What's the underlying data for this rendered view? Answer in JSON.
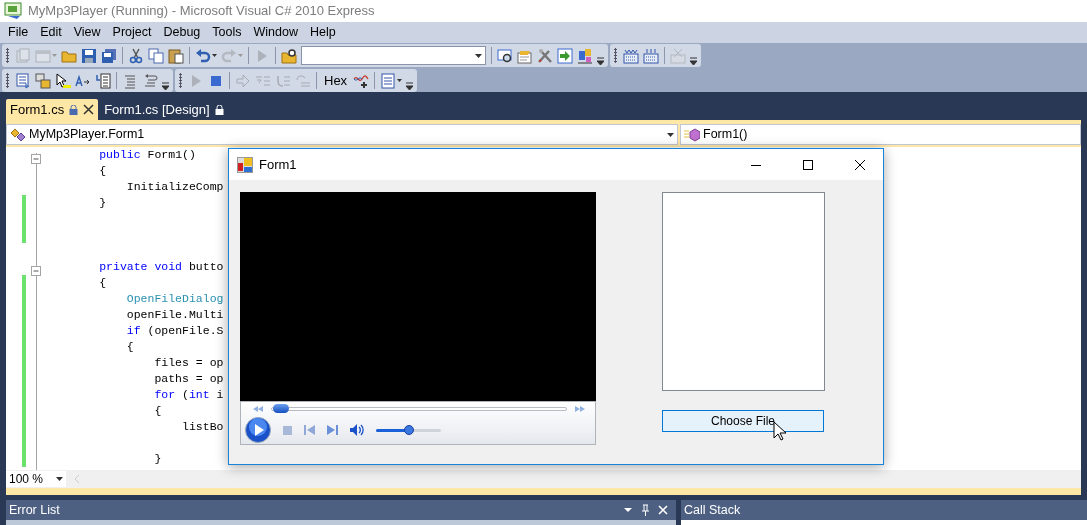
{
  "window": {
    "title": "MyMp3Player (Running) - Microsoft Visual C# 2010 Express"
  },
  "menu": [
    "File",
    "Edit",
    "View",
    "Project",
    "Debug",
    "Tools",
    "Window",
    "Help"
  ],
  "toolbars": [
    {
      "items": [
        {
          "kind": "button",
          "disabled": true
        },
        {
          "kind": "button",
          "disabled": true,
          "dropdown": true
        },
        {
          "kind": "button",
          "disabled": false
        },
        {
          "kind": "button",
          "disabled": false
        },
        {
          "kind": "button",
          "disabled": false
        },
        {
          "kind": "separator"
        },
        {
          "kind": "button",
          "disabled": false
        },
        {
          "kind": "button",
          "disabled": false
        },
        {
          "kind": "button",
          "disabled": false
        },
        {
          "kind": "separator"
        },
        {
          "kind": "button",
          "disabled": false,
          "dropdown": true
        },
        {
          "kind": "button",
          "disabled": true,
          "dropdown": true
        },
        {
          "kind": "separator"
        },
        {
          "kind": "button",
          "disabled": true
        },
        {
          "kind": "separator"
        },
        {
          "kind": "button",
          "disabled": false
        },
        {
          "kind": "combo"
        },
        {
          "kind": "separator"
        },
        {
          "kind": "button",
          "disabled": false
        },
        {
          "kind": "button",
          "disabled": false
        },
        {
          "kind": "button",
          "disabled": false
        },
        {
          "kind": "button",
          "disabled": false
        },
        {
          "kind": "button",
          "disabled": false
        },
        {
          "kind": "overflow"
        }
      ]
    },
    {
      "items": [
        {
          "kind": "button",
          "disabled": false
        },
        {
          "kind": "button",
          "disabled": false
        },
        {
          "kind": "separator"
        },
        {
          "kind": "button",
          "disabled": true
        },
        {
          "kind": "overflow"
        }
      ]
    },
    {
      "items": [
        {
          "kind": "button",
          "disabled": false
        },
        {
          "kind": "button",
          "disabled": false
        },
        {
          "kind": "button",
          "disabled": false
        },
        {
          "kind": "button",
          "disabled": false
        },
        {
          "kind": "button",
          "disabled": false
        },
        {
          "kind": "separator"
        },
        {
          "kind": "button",
          "disabled": false
        },
        {
          "kind": "button",
          "disabled": false
        },
        {
          "kind": "overflow"
        }
      ]
    },
    {
      "items": [
        {
          "kind": "button",
          "disabled": true
        },
        {
          "kind": "button",
          "disabled": false
        },
        {
          "kind": "separator"
        },
        {
          "kind": "button",
          "disabled": true
        },
        {
          "kind": "button",
          "disabled": true
        },
        {
          "kind": "button",
          "disabled": true
        },
        {
          "kind": "button",
          "disabled": true
        },
        {
          "kind": "separator"
        },
        {
          "kind": "text",
          "label": "Hex"
        },
        {
          "kind": "button",
          "disabled": false
        },
        {
          "kind": "separator"
        },
        {
          "kind": "button",
          "disabled": false,
          "dropdown": true
        },
        {
          "kind": "overflow"
        }
      ]
    }
  ],
  "tabs": [
    {
      "label": "Form1.cs",
      "selected": true,
      "locked": true,
      "closable": true
    },
    {
      "label": "Form1.cs [Design]",
      "selected": false,
      "locked": true,
      "closable": false
    }
  ],
  "navigation": {
    "type_selector": "MyMp3Player.Form1",
    "member_selector": "Form1()"
  },
  "code_lines": [
    {
      "segments": [
        {
          "text": "        public",
          "kind": "keyword"
        },
        {
          "text": " Form1()"
        }
      ],
      "changed": false,
      "outline_toggle": true
    },
    {
      "segments": [
        {
          "text": "        {"
        }
      ],
      "changed": false,
      "outline_toggle": false
    },
    {
      "segments": [
        {
          "text": "            InitializeComp"
        }
      ],
      "changed": false,
      "outline_toggle": false
    },
    {
      "segments": [
        {
          "text": "        }"
        }
      ],
      "changed": true,
      "outline_toggle": false
    },
    {
      "changed": true,
      "outline_toggle": false
    },
    {
      "changed": true,
      "outline_toggle": false
    },
    {
      "changed": false,
      "outline_toggle": false
    },
    {
      "segments": [
        {
          "text": "        private void",
          "kind": "keyword"
        },
        {
          "text": " butto"
        }
      ],
      "changed": false,
      "outline_toggle": true
    },
    {
      "segments": [
        {
          "text": "        {"
        }
      ],
      "changed": true,
      "outline_toggle": false
    },
    {
      "segments": [
        {
          "text": "            OpenFileDialog",
          "kind": "type"
        }
      ],
      "changed": true,
      "outline_toggle": false
    },
    {
      "segments": [
        {
          "text": "            openFile.Multi"
        }
      ],
      "changed": true,
      "outline_toggle": false
    },
    {
      "segments": [
        {
          "text": "            if",
          "kind": "keyword"
        },
        {
          "text": " (openFile.S"
        }
      ],
      "changed": true,
      "outline_toggle": false
    },
    {
      "segments": [
        {
          "text": "            {"
        }
      ],
      "changed": true,
      "outline_toggle": false
    },
    {
      "segments": [
        {
          "text": "                files = op"
        }
      ],
      "changed": true,
      "outline_toggle": false
    },
    {
      "segments": [
        {
          "text": "                paths = op"
        }
      ],
      "changed": true,
      "outline_toggle": false
    },
    {
      "segments": [
        {
          "text": "                for",
          "kind": "keyword"
        },
        {
          "text": " ("
        },
        {
          "text": "int",
          "kind": "keyword"
        },
        {
          "text": " i"
        }
      ],
      "changed": true,
      "outline_toggle": false
    },
    {
      "segments": [
        {
          "text": "                {"
        }
      ],
      "changed": true,
      "outline_toggle": false
    },
    {
      "segments": [
        {
          "text": "                    listBo"
        }
      ],
      "changed": true,
      "outline_toggle": false
    },
    {
      "changed": true,
      "outline_toggle": false
    },
    {
      "segments": [
        {
          "text": "                }"
        }
      ],
      "changed": true,
      "outline_toggle": false
    }
  ],
  "zoom": "100 %",
  "form": {
    "title": "Form1",
    "player": {
      "seek": {
        "level": 0.01
      },
      "volume": {
        "level": 0.5
      }
    },
    "button": {
      "label": "Choose File",
      "hovered": true
    }
  },
  "panels": [
    {
      "title": "Error List"
    },
    {
      "title": "Call Stack"
    }
  ]
}
